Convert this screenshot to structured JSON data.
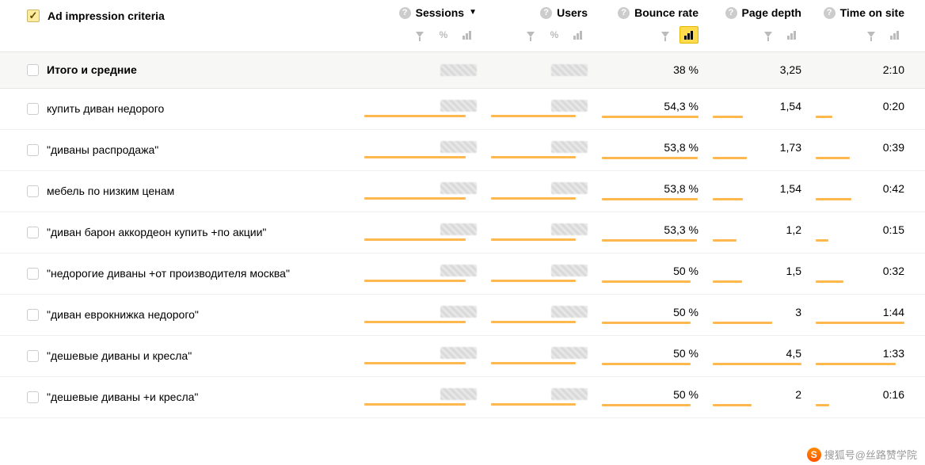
{
  "header": {
    "dimension_label": "Ad impression criteria",
    "columns": {
      "sessions": "Sessions",
      "users": "Users",
      "bounce": "Bounce rate",
      "depth": "Page depth",
      "time": "Time on site"
    },
    "sort_indicator": "▼",
    "percent_symbol": "%"
  },
  "totals": {
    "label": "Итого и средние",
    "bounce": "38 %",
    "depth": "3,25",
    "time": "2:10"
  },
  "rows": [
    {
      "label": "купить диван недорого",
      "bounce": "54,3 %",
      "bounce_bar": 100,
      "depth": "1,54",
      "depth_bar": 34,
      "time": "0:20",
      "time_bar": 19
    },
    {
      "label": "\"диваны распродажа\"",
      "bounce": "53,8 %",
      "bounce_bar": 99,
      "depth": "1,73",
      "depth_bar": 38,
      "time": "0:39",
      "time_bar": 38
    },
    {
      "label": "мебель по низким ценам",
      "bounce": "53,8 %",
      "bounce_bar": 99,
      "depth": "1,54",
      "depth_bar": 34,
      "time": "0:42",
      "time_bar": 40
    },
    {
      "label": "\"диван барон аккордеон купить +по акции\"",
      "bounce": "53,3 %",
      "bounce_bar": 98,
      "depth": "1,2",
      "depth_bar": 27,
      "time": "0:15",
      "time_bar": 14
    },
    {
      "label": "\"недорогие диваны +от производителя москва\"",
      "bounce": "50 %",
      "bounce_bar": 92,
      "depth": "1,5",
      "depth_bar": 33,
      "time": "0:32",
      "time_bar": 31
    },
    {
      "label": "\"диван еврокнижка недорого\"",
      "bounce": "50 %",
      "bounce_bar": 92,
      "depth": "3",
      "depth_bar": 67,
      "time": "1:44",
      "time_bar": 100
    },
    {
      "label": "\"дешевые диваны и кресла\"",
      "bounce": "50 %",
      "bounce_bar": 92,
      "depth": "4,5",
      "depth_bar": 100,
      "time": "1:33",
      "time_bar": 90
    },
    {
      "label": "\"дешевые диваны +и кресла\"",
      "bounce": "50 %",
      "bounce_bar": 92,
      "depth": "2",
      "depth_bar": 44,
      "time": "0:16",
      "time_bar": 15
    }
  ],
  "watermark": "搜狐号@丝路赞学院"
}
